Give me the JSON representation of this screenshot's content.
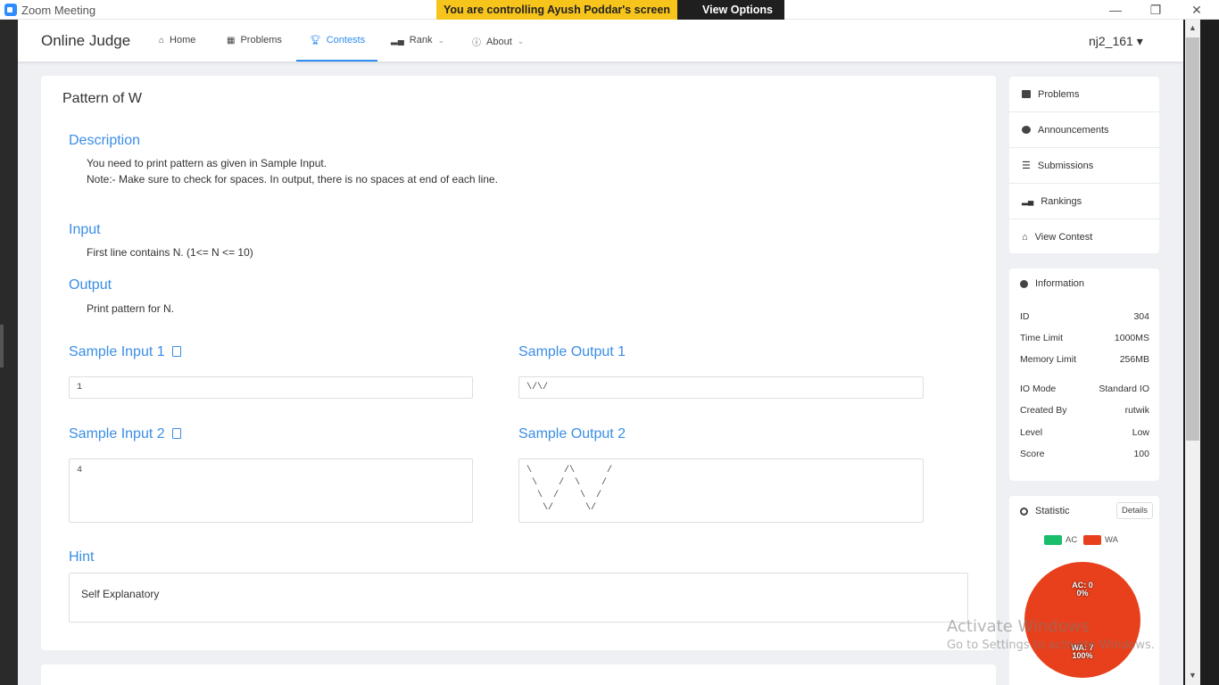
{
  "zoom": {
    "title": "Zoom Meeting",
    "banner": "You are controlling Ayush Poddar's screen",
    "view_options": "View Options"
  },
  "header": {
    "brand": "Online Judge",
    "nav": [
      {
        "label": "Home"
      },
      {
        "label": "Problems"
      },
      {
        "label": "Contests"
      },
      {
        "label": "Rank"
      },
      {
        "label": "About"
      }
    ],
    "user": "nj2_161"
  },
  "problem": {
    "title": "Pattern of W",
    "description_heading": "Description",
    "description_line1": "You need to print pattern as given in Sample Input.",
    "description_line2": "Note:- Make sure to check for spaces. In output, there is no spaces at end of each line.",
    "input_heading": "Input",
    "input_text": "First line contains N. (1<= N <= 10)",
    "output_heading": "Output",
    "output_text": "Print pattern for N.",
    "samples": [
      {
        "input_label": "Sample Input 1",
        "output_label": "Sample Output 1",
        "input": "1",
        "output": "\\/\\/"
      },
      {
        "input_label": "Sample Input 2",
        "output_label": "Sample Output 2",
        "input": "4",
        "output": "\\      /\\      /\n \\    /  \\    /\n  \\  /    \\  /\n   \\/      \\/"
      }
    ],
    "hint_heading": "Hint",
    "hint_text": "Self Explanatory"
  },
  "sidebar": {
    "menu": [
      {
        "label": "Problems"
      },
      {
        "label": "Announcements"
      },
      {
        "label": "Submissions"
      },
      {
        "label": "Rankings"
      },
      {
        "label": "View Contest"
      }
    ],
    "info_title": "Information",
    "info": [
      {
        "key": "ID",
        "value": "304"
      },
      {
        "key": "Time Limit",
        "value": "1000MS"
      },
      {
        "key": "Memory Limit",
        "value": "256MB"
      },
      {
        "key": "IO Mode",
        "value": "Standard IO"
      },
      {
        "key": "Created By",
        "value": "rutwik"
      },
      {
        "key": "Level",
        "value": "Low"
      },
      {
        "key": "Score",
        "value": "100"
      }
    ],
    "stat_title": "Statistic",
    "details": "Details",
    "legend_ac": "AC",
    "legend_wa": "WA",
    "ac_label": "AC: 0",
    "ac_pct": "0%",
    "wa_label": "WA: 7",
    "wa_pct": "100%"
  },
  "watermark": {
    "line1": "Activate Windows",
    "line2": "Go to Settings to activate Windows."
  },
  "colors": {
    "accent": "#2d8cf0",
    "ac": "#19be6b",
    "wa": "#e8401c",
    "banner": "#f7c41b"
  }
}
